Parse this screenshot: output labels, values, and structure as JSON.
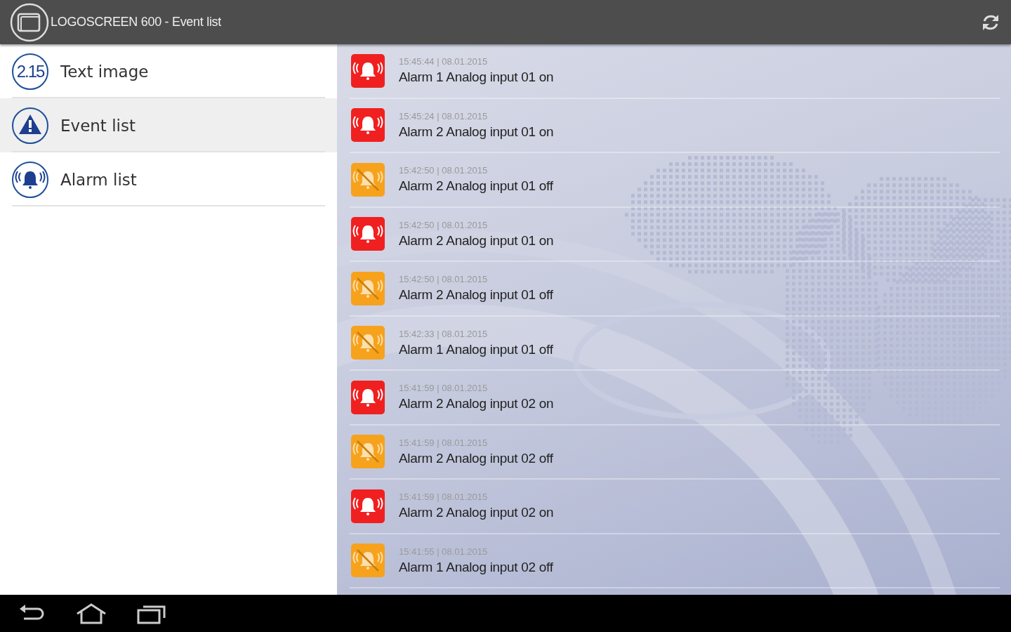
{
  "action_bar": {
    "title": "LOGOSCREEN 600 - Event list"
  },
  "menu": [
    {
      "kind": "number",
      "icon_text": "2.15",
      "label": "Text image",
      "selected": false
    },
    {
      "kind": "warning",
      "label": "Event list",
      "selected": true
    },
    {
      "kind": "bell",
      "label": "Alarm list",
      "selected": false
    }
  ],
  "events": [
    {
      "time": "15:45:44 | 08.01.2015",
      "text": "Alarm 1 Analog input 01 on",
      "active": true
    },
    {
      "time": "15:45:24 | 08.01.2015",
      "text": "Alarm 2 Analog input 01 on",
      "active": true
    },
    {
      "time": "15:42:50 | 08.01.2015",
      "text": "Alarm 2 Analog input 01 off",
      "active": false
    },
    {
      "time": "15:42:50 | 08.01.2015",
      "text": "Alarm 2 Analog input 01 on",
      "active": true
    },
    {
      "time": "15:42:50 | 08.01.2015",
      "text": "Alarm 2 Analog input 01 off",
      "active": false
    },
    {
      "time": "15:42:33 | 08.01.2015",
      "text": "Alarm 1 Analog input 01 off",
      "active": false
    },
    {
      "time": "15:41:59 | 08.01.2015",
      "text": "Alarm 2 Analog input 02 on",
      "active": true
    },
    {
      "time": "15:41:59 | 08.01.2015",
      "text": "Alarm 2 Analog input 02 off",
      "active": false
    },
    {
      "time": "15:41:59 | 08.01.2015",
      "text": "Alarm 2 Analog input 02 on",
      "active": true
    },
    {
      "time": "15:41:55 | 08.01.2015",
      "text": "Alarm 1 Analog input 02 off",
      "active": false
    }
  ]
}
